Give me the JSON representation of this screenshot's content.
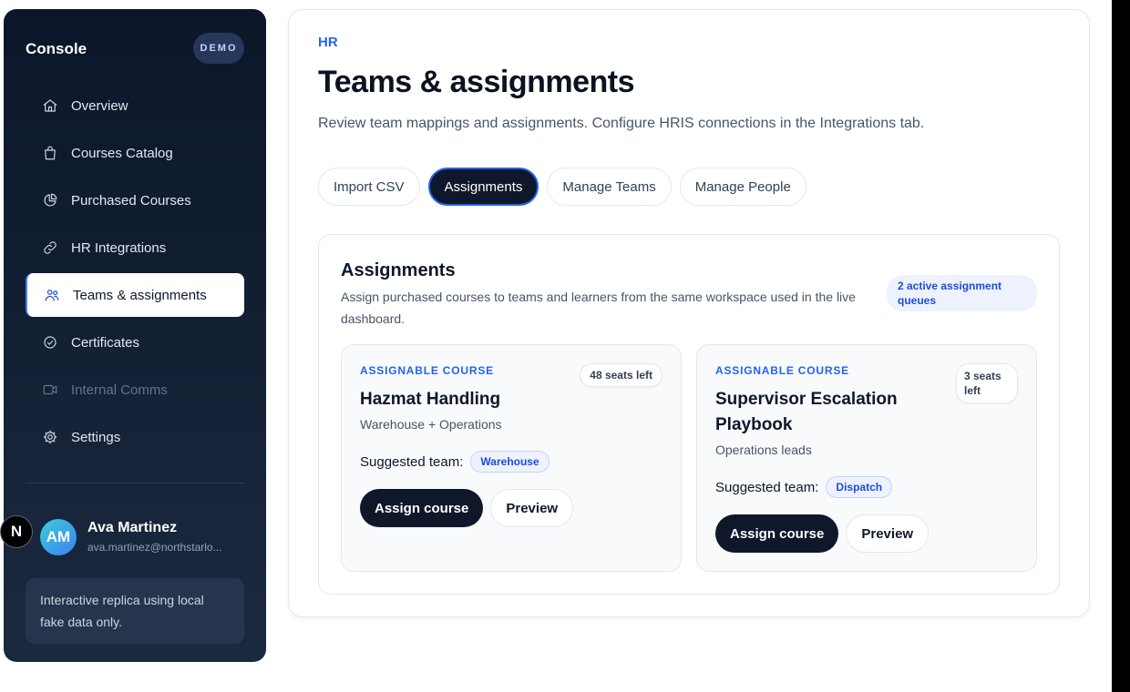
{
  "sidebar": {
    "brand": "Console",
    "badge": "DEMO",
    "items": [
      {
        "label": "Overview",
        "icon": "home-icon"
      },
      {
        "label": "Courses Catalog",
        "icon": "bag-icon"
      },
      {
        "label": "Purchased Courses",
        "icon": "pie-chart-icon"
      },
      {
        "label": "HR Integrations",
        "icon": "link-icon"
      },
      {
        "label": "Teams & assignments",
        "icon": "users-icon",
        "active": true
      },
      {
        "label": "Certificates",
        "icon": "check-circle-icon"
      },
      {
        "label": "Internal Comms",
        "icon": "video-icon",
        "disabled": true
      },
      {
        "label": "Settings",
        "icon": "gear-icon"
      }
    ],
    "user": {
      "initials": "AM",
      "name": "Ava Martinez",
      "email": "ava.martinez@northstarlo..."
    },
    "note": "Interactive replica using local fake data only."
  },
  "overlay_badge": "N",
  "header": {
    "breadcrumb": "HR",
    "title": "Teams & assignments",
    "description": "Review team mappings and assignments. Configure HRIS connections in the Integrations tab."
  },
  "tabs": [
    {
      "label": "Import CSV"
    },
    {
      "label": "Assignments",
      "active": true
    },
    {
      "label": "Manage Teams"
    },
    {
      "label": "Manage People"
    }
  ],
  "assignments": {
    "title": "Assignments",
    "subtitle": "Assign purchased courses to teams and learners from the same workspace used in the live dashboard.",
    "queue_badge": "2 active assignment queues",
    "courses": [
      {
        "eyebrow": "ASSIGNABLE COURSE",
        "seats": "48 seats left",
        "title": "Hazmat Handling",
        "meta": "Warehouse + Operations",
        "suggested_label": "Suggested team:",
        "team": "Warehouse",
        "primary_action": "Assign course",
        "secondary_action": "Preview"
      },
      {
        "eyebrow": "ASSIGNABLE COURSE",
        "seats": "3 seats left",
        "title": "Supervisor Escalation Playbook",
        "meta": "Operations leads",
        "suggested_label": "Suggested team:",
        "team": "Dispatch",
        "primary_action": "Assign course",
        "secondary_action": "Preview"
      }
    ]
  },
  "colors": {
    "accent": "#2563eb",
    "sidebar_bg": "#0b1629",
    "primary_button": "#0f172a"
  }
}
